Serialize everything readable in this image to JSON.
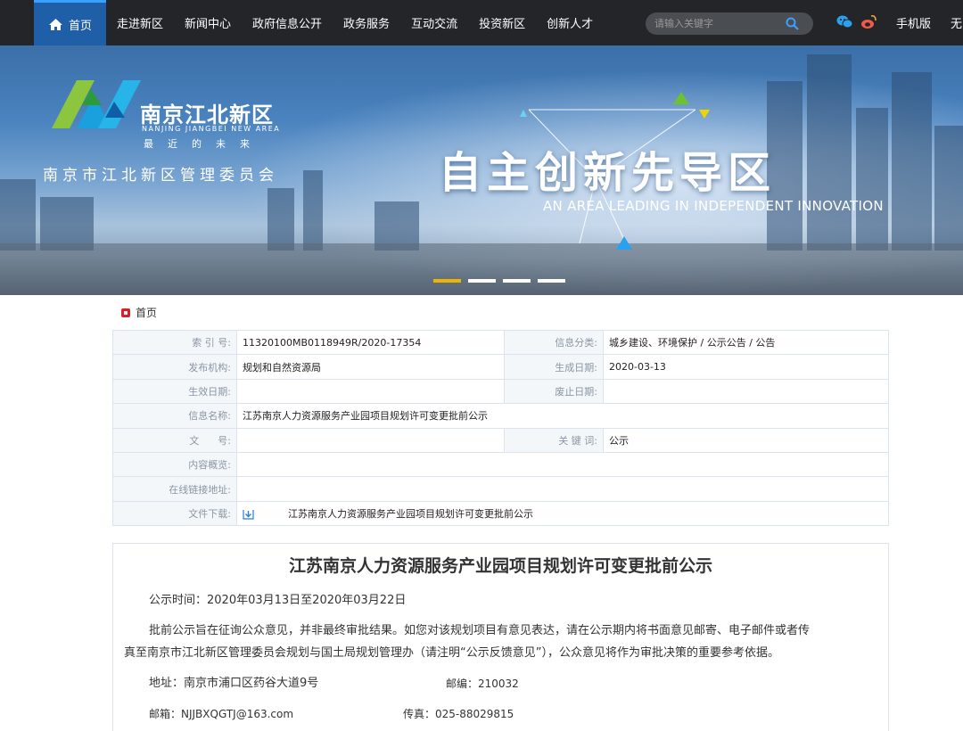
{
  "nav": {
    "home": "首页",
    "items": [
      "走进新区",
      "新闻中心",
      "政府信息公开",
      "政务服务",
      "互动交流",
      "投资新区",
      "创新人才"
    ],
    "search_placeholder": "请输入关键字",
    "mobile": "手机版",
    "accessible": "无"
  },
  "banner": {
    "logo_title": "南京江北新区",
    "logo_en": "NANJING JIANGBEI NEW AREA",
    "logo_motto": "最近的未来",
    "logo_sub": "南京市江北新区管理委员会",
    "slogan": "自主创新先导区",
    "slogan_en": "AN AREA LEADING IN INDEPENDENT INNOVATION",
    "slide_count": 4,
    "active_slide": 1
  },
  "breadcrumb": {
    "home": "首页"
  },
  "info": {
    "rows": [
      {
        "k1": "索 引 号:",
        "v1": "11320100MB0118949R/2020-17354",
        "k2": "信息分类:",
        "v2": "城乡建设、环境保护 / 公示公告 / 公告"
      },
      {
        "k1": "发布机构:",
        "v1": "规划和自然资源局",
        "k2": "生成日期:",
        "v2": "2020-03-13"
      },
      {
        "k1": "生效日期:",
        "v1": "",
        "k2": "废止日期:",
        "v2": ""
      }
    ],
    "name_label": "信息名称:",
    "name_value": "江苏南京人力资源服务产业园项目规划许可变更批前公示",
    "docno_label": "文      号:",
    "docno_value": "",
    "keyword_label": "关 键 词:",
    "keyword_value": "公示",
    "summary_label": "内容概览:",
    "summary_value": "",
    "link_label": "在线链接地址:",
    "link_value": "",
    "download_label": "文件下载:",
    "download_value": "江苏南京人力资源服务产业园项目规划许可变更批前公示"
  },
  "article": {
    "title": "江苏南京人力资源服务产业园项目规划许可变更批前公示",
    "period": "公示时间：2020年03月13日至2020年03月22日",
    "body_line1": "批前公示旨在征询公众意见，并非最终审批结果。如您对该规划项目有意见表达，请在公示期内将书面意见邮寄、电子邮件或者传",
    "body_line2": "真至南京市江北新区管理委员会规划与国土局规划管理办（请注明“公示反馈意见”），公众意见将作为审批决策的重要参考依据。",
    "address": "地址：南京市浦口区药谷大道9号",
    "postcode": "邮编：210032",
    "email": "邮箱：NJJBXQGTJ@163.com",
    "fax": "传真：025-88029815"
  },
  "colors": {
    "nav_bg": "#232528",
    "nav_active": "#1f5fa8",
    "accent_red": "#d8202a",
    "slide_active": "#f0b400"
  }
}
